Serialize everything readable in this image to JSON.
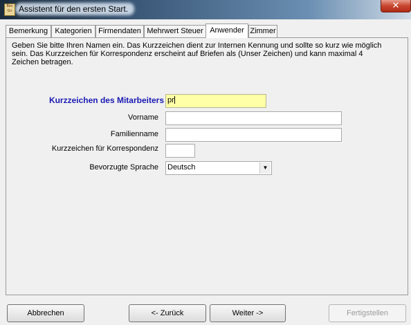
{
  "window": {
    "title": "Assistent für den ersten Start.",
    "icon_text": "Bes Gn",
    "close_glyph": "✕"
  },
  "tabs": [
    {
      "label": "Bemerkung",
      "active": false
    },
    {
      "label": "Kategorien",
      "active": false
    },
    {
      "label": "Firmendaten",
      "active": false
    },
    {
      "label": "Mehrwert Steuer",
      "active": false
    },
    {
      "label": "Anwender",
      "active": true
    },
    {
      "label": "Zimmer",
      "active": false
    }
  ],
  "panel": {
    "description": "Geben Sie bitte Ihren Namen ein. Das Kurzzeichen dient zur Internen Kennung und sollte so kurz wie möglich sein. Das Kurzzeichen für Korrespondenz erscheint auf Briefen als (Unser Zeichen) und kann maximal 4 Zeichen betragen.",
    "fields": {
      "kurzzeichen": {
        "label": "Kurzzeichen des Mitarbeiters",
        "value": "pr"
      },
      "vorname": {
        "label": "Vorname",
        "value": ""
      },
      "familienname": {
        "label": "Familienname",
        "value": ""
      },
      "korrespondenz": {
        "label": "Kurzzeichen für Korrespondenz",
        "value": ""
      },
      "sprache": {
        "label": "Bevorzugte Sprache",
        "value": "Deutsch"
      }
    }
  },
  "buttons": {
    "cancel": "Abbrechen",
    "back": "<- Zurück",
    "next": "Weiter ->",
    "finish": "Fertigstellen"
  },
  "colors": {
    "primary_label": "#1a1ab4",
    "highlight_field": "#ffffa8",
    "close_button": "#c7452f"
  }
}
